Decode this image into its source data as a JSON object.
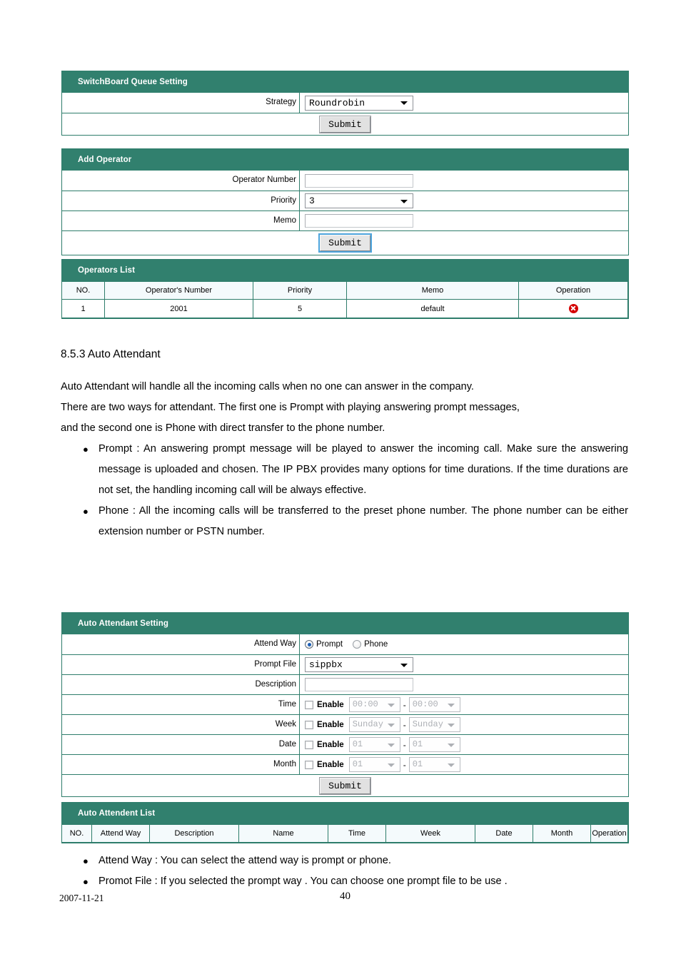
{
  "colors": {
    "panel_header": "#31806e",
    "panel_border": "#2e7d6b",
    "table_header_bg": "#f4fafc",
    "delete_icon": "#d40000",
    "radio_selected": "#1c5fb6"
  },
  "switchboard_queue": {
    "title": "SwitchBoard Queue Setting",
    "strategy_label": "Strategy",
    "strategy_value": "Roundrobin",
    "submit_label": "Submit"
  },
  "add_operator": {
    "title": "Add Operator",
    "operator_number_label": "Operator Number",
    "operator_number_value": "",
    "priority_label": "Priority",
    "priority_value": "3",
    "memo_label": "Memo",
    "memo_value": "",
    "submit_label": "Submit"
  },
  "operators_list": {
    "title": "Operators List",
    "columns": [
      "NO.",
      "Operator's Number",
      "Priority",
      "Memo",
      "Operation"
    ],
    "rows": [
      {
        "no": "1",
        "number": "2001",
        "priority": "5",
        "memo": "default",
        "operation_icon": "delete-icon"
      }
    ]
  },
  "section": {
    "heading": "8.5.3 Auto Attendant",
    "para_line1": "Auto Attendant will handle all the incoming calls when no one can answer in the company.",
    "para_line2": "There are two ways for attendant.   The first one is Prompt with playing answering prompt messages,",
    "para_line3": "and the second one is Phone with direct transfer to the phone number.",
    "bullets": [
      {
        "dot": "●",
        "text": "Prompt : An answering prompt message will be played to answer the incoming call.   Make sure the answering message is uploaded and chosen. The IP PBX provides many options for time durations.   If the time durations are not set, the handling incoming call will be always effective."
      },
      {
        "dot": "●",
        "text": "Phone : All the incoming calls will be transferred to the preset phone number. The phone number can be either extension number or PSTN number."
      }
    ]
  },
  "auto_attendant_setting": {
    "title": "Auto Attendant Setting",
    "attend_way_label": "Attend Way",
    "attend_way_options": [
      {
        "label": "Prompt",
        "selected": true
      },
      {
        "label": "Phone",
        "selected": false
      }
    ],
    "prompt_file_label": "Prompt File",
    "prompt_file_value": "sippbx",
    "description_label": "Description",
    "description_value": "",
    "schedule_rows": [
      {
        "label": "Time",
        "enable_label": "Enable",
        "checked": false,
        "from": "00:00",
        "to": "00:00",
        "separator": "-"
      },
      {
        "label": "Week",
        "enable_label": "Enable",
        "checked": false,
        "from": "Sunday",
        "to": "Sunday",
        "separator": "-"
      },
      {
        "label": "Date",
        "enable_label": "Enable",
        "checked": false,
        "from": "01",
        "to": "01",
        "separator": "-"
      },
      {
        "label": "Month",
        "enable_label": "Enable",
        "checked": false,
        "from": "01",
        "to": "01",
        "separator": "-"
      }
    ],
    "submit_label": "Submit"
  },
  "auto_attendent_list": {
    "title": "Auto Attendent List",
    "columns": [
      "NO.",
      "Attend Way",
      "Description",
      "Name",
      "Time",
      "Week",
      "Date",
      "Month",
      "Operation"
    ],
    "rows": []
  },
  "bottom_bullets": [
    {
      "dot": "●",
      "text": "Attend Way : You can select the attend way is prompt or phone."
    },
    {
      "dot": "●",
      "text": "Promot File : If you selected the prompt way . You can choose one prompt file to be use ."
    }
  ],
  "footer": {
    "date": "2007-11-21",
    "page_number": "40"
  }
}
